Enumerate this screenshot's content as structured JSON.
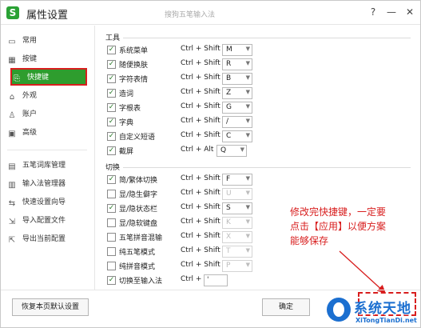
{
  "window": {
    "logo_letter": "S",
    "title": "属性设置",
    "subtitle": "搜狗五笔输入法",
    "help": "?",
    "minimize": "—",
    "close": "✕"
  },
  "sidebar": {
    "items": [
      {
        "label": "常用",
        "icon": "monitor-icon",
        "glyph": "▭"
      },
      {
        "label": "按键",
        "icon": "keyboard-icon",
        "glyph": "▦"
      },
      {
        "label": "快捷键",
        "icon": "shortcut-icon",
        "glyph": "⎘"
      },
      {
        "label": "外观",
        "icon": "shirt-icon",
        "glyph": "⌂"
      },
      {
        "label": "账户",
        "icon": "user-icon",
        "glyph": "♙"
      },
      {
        "label": "高级",
        "icon": "advanced-icon",
        "glyph": "▣"
      }
    ],
    "tools": [
      {
        "label": "五笔词库管理",
        "icon": "dictionary-icon",
        "glyph": "▤"
      },
      {
        "label": "输入法管理器",
        "icon": "manager-icon",
        "glyph": "▥"
      },
      {
        "label": "快速设置向导",
        "icon": "wizard-icon",
        "glyph": "⇆"
      },
      {
        "label": "导入配置文件",
        "icon": "import-icon",
        "glyph": "⇲"
      },
      {
        "label": "导出当前配置",
        "icon": "export-icon",
        "glyph": "⇱"
      }
    ]
  },
  "sections": {
    "tools_title": "工具",
    "switch_title": "切换"
  },
  "tools_rows": [
    {
      "label": "系统菜单",
      "checked": true,
      "modifier": "Ctrl + Shift +",
      "key": "M",
      "enabled": true
    },
    {
      "label": "随便换肤",
      "checked": true,
      "modifier": "Ctrl + Shift +",
      "key": "R",
      "enabled": true
    },
    {
      "label": "字符表情",
      "checked": true,
      "modifier": "Ctrl + Shift +",
      "key": "B",
      "enabled": true
    },
    {
      "label": "造词",
      "checked": true,
      "modifier": "Ctrl + Shift +",
      "key": "Z",
      "enabled": true
    },
    {
      "label": "字根表",
      "checked": true,
      "modifier": "Ctrl + Shift +",
      "key": "G",
      "enabled": true
    },
    {
      "label": "字典",
      "checked": true,
      "modifier": "Ctrl + Shift +",
      "key": "/",
      "enabled": true
    },
    {
      "label": "自定义短语",
      "checked": true,
      "modifier": "Ctrl + Shift +",
      "key": "C",
      "enabled": true
    },
    {
      "label": "截屏",
      "checked": true,
      "modifier": "Ctrl + Alt +",
      "key": "Q",
      "enabled": true
    }
  ],
  "switch_rows": [
    {
      "label": "简/繁体切换",
      "checked": true,
      "modifier": "Ctrl + Shift +",
      "key": "F",
      "enabled": true
    },
    {
      "label": "显/隐生僻字",
      "checked": false,
      "modifier": "Ctrl + Shift +",
      "key": "U",
      "enabled": false
    },
    {
      "label": "显/隐状态栏",
      "checked": true,
      "modifier": "Ctrl + Shift +",
      "key": "S",
      "enabled": true
    },
    {
      "label": "显/隐软键盘",
      "checked": false,
      "modifier": "Ctrl + Shift +",
      "key": "K",
      "enabled": false
    },
    {
      "label": "五笔拼音混输",
      "checked": false,
      "modifier": "Ctrl + Shift +",
      "key": "X",
      "enabled": false
    },
    {
      "label": "纯五笔模式",
      "checked": false,
      "modifier": "Ctrl + Shift +",
      "key": "T",
      "enabled": false
    },
    {
      "label": "纯拼音模式",
      "checked": false,
      "modifier": "Ctrl + Shift +",
      "key": "P",
      "enabled": false
    },
    {
      "label": "切换至输入法",
      "checked": true,
      "modifier": "Ctrl +",
      "key": "'",
      "enabled": true
    }
  ],
  "annotation": {
    "lines": [
      "修改完快捷键，一定要",
      "点击【应用】以便方案",
      "能够保存"
    ],
    "color": "#d81e1e"
  },
  "footer": {
    "restore_label": "恢复本页默认设置",
    "ok_label": "确定",
    "apply_label": ""
  },
  "watermark": {
    "text": "系统天地",
    "url": "XiTongTianDi.net"
  },
  "colors": {
    "accent": "#2e9d2e",
    "highlight": "#d81e1e",
    "watermark": "#1b6fd0"
  }
}
